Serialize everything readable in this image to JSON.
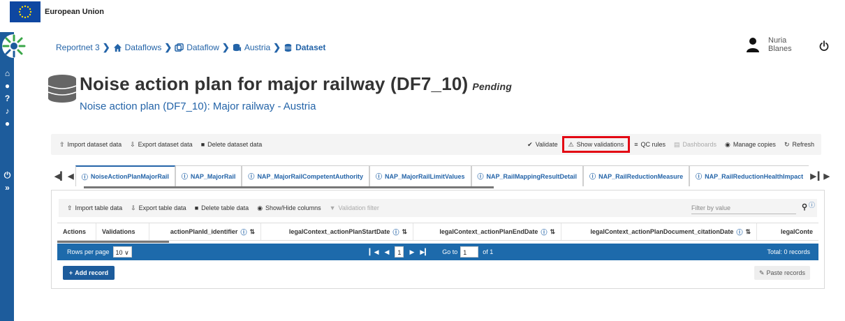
{
  "eu_bar": {
    "name": "European Union"
  },
  "breadcrumb": [
    {
      "label": "Reportnet 3",
      "icon": ""
    },
    {
      "label": "Dataflows",
      "icon": "home-icon"
    },
    {
      "label": "Dataflow",
      "icon": "clone-icon"
    },
    {
      "label": "Austria",
      "icon": "database-group-icon"
    },
    {
      "label": "Dataset",
      "icon": "database-icon"
    }
  ],
  "user": {
    "first": "Nuria",
    "last": "Blanes"
  },
  "header": {
    "title": "Noise action plan for major railway (DF7_10)",
    "status": "Pending",
    "subtitle": "Noise action plan (DF7_10): Major railway - Austria"
  },
  "toolbar": {
    "import": "Import dataset data",
    "export": "Export dataset data",
    "delete": "Delete dataset data",
    "validate": "Validate",
    "show_validations": "Show validations",
    "qc_rules": "QC rules",
    "dashboards": "Dashboards",
    "manage_copies": "Manage copies",
    "refresh": "Refresh"
  },
  "tabs": [
    "NoiseActionPlanMajorRail",
    "NAP_MajorRail",
    "NAP_MajorRailCompetentAuthority",
    "NAP_MajorRailLimitValues",
    "NAP_RailMappingResultDetail",
    "NAP_RailReductionMeasure",
    "NAP_RailReductionHealthImpact"
  ],
  "table_toolbar": {
    "import": "Import table data",
    "export": "Export table data",
    "delete": "Delete table data",
    "show_hide": "Show/Hide columns",
    "validation_filter": "Validation filter",
    "filter_placeholder": "Filter by value"
  },
  "columns": {
    "actions": "Actions",
    "validations": "Validations",
    "c1": "actionPlanId_identifier",
    "c2": "legalContext_actionPlanStartDate",
    "c3": "legalContext_actionPlanEndDate",
    "c4": "legalContext_actionPlanDocument_citationDate",
    "c5": "legalConte"
  },
  "pager": {
    "rows_label": "Rows per page",
    "rows_value": "10",
    "page": "1",
    "goto_label": "Go to",
    "goto_value": "1",
    "of_label": "of 1",
    "total": "Total: 0 records"
  },
  "buttons": {
    "add_record": "Add record",
    "paste_records": "Paste records"
  },
  "colors": {
    "primary": "#1d5c9c",
    "link": "#2464a8",
    "highlight": "#e30613",
    "pager": "#1d6aab"
  }
}
